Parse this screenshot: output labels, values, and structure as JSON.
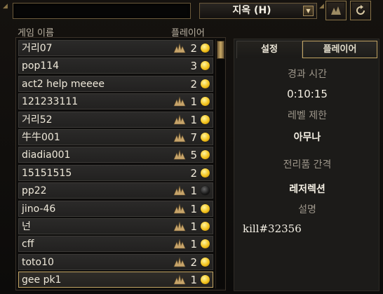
{
  "top_bar": {
    "search_value": "",
    "difficulty": "지옥 (H)"
  },
  "list_header": {
    "name_col": "게임 이름",
    "players_col": "플레이어"
  },
  "games": [
    {
      "name": "거리07",
      "players": "2",
      "friends": true,
      "coin": "gold",
      "selected": false
    },
    {
      "name": "pop114",
      "players": "3",
      "friends": false,
      "coin": "gold",
      "selected": false
    },
    {
      "name": "act2 help meeee",
      "players": "2",
      "friends": false,
      "coin": "gold",
      "selected": false
    },
    {
      "name": "121233111",
      "players": "1",
      "friends": true,
      "coin": "gold",
      "selected": false
    },
    {
      "name": "거리52",
      "players": "1",
      "friends": true,
      "coin": "gold",
      "selected": false
    },
    {
      "name": "牛牛001",
      "players": "7",
      "friends": true,
      "coin": "gold",
      "selected": false
    },
    {
      "name": "diadia001",
      "players": "5",
      "friends": true,
      "coin": "gold",
      "selected": false
    },
    {
      "name": "15151515",
      "players": "2",
      "friends": false,
      "coin": "gold",
      "selected": false
    },
    {
      "name": "pp22",
      "players": "1",
      "friends": true,
      "coin": "dark",
      "selected": false
    },
    {
      "name": "jino-46",
      "players": "1",
      "friends": true,
      "coin": "gold",
      "selected": false
    },
    {
      "name": "넌",
      "players": "1",
      "friends": true,
      "coin": "gold",
      "selected": false
    },
    {
      "name": "cff",
      "players": "1",
      "friends": true,
      "coin": "gold",
      "selected": false
    },
    {
      "name": "toto10",
      "players": "2",
      "friends": true,
      "coin": "gold",
      "selected": false
    },
    {
      "name": "gee pk1",
      "players": "1",
      "friends": true,
      "coin": "gold",
      "selected": true
    }
  ],
  "panel": {
    "tab_settings": "설정",
    "tab_players": "플레이어",
    "elapsed_label": "경과 시간",
    "elapsed_value": "0:10:15",
    "level_label": "레벨 제한",
    "level_value": "아무나",
    "loot_label": "전리품 간격",
    "loot_value": "레저렉션",
    "desc_label": "설명",
    "desc_value": "kill#32356"
  },
  "icons": {
    "dropdown": "chevron-down-icon",
    "filter": "triangle-filter-icon",
    "refresh": "refresh-icon",
    "friends": "friends-icon",
    "coin": "gold-coin-icon"
  },
  "colors": {
    "gold_border": "#c2a463",
    "coin_gold": "#f2c21c",
    "panel_bg": "#1c1b19"
  }
}
